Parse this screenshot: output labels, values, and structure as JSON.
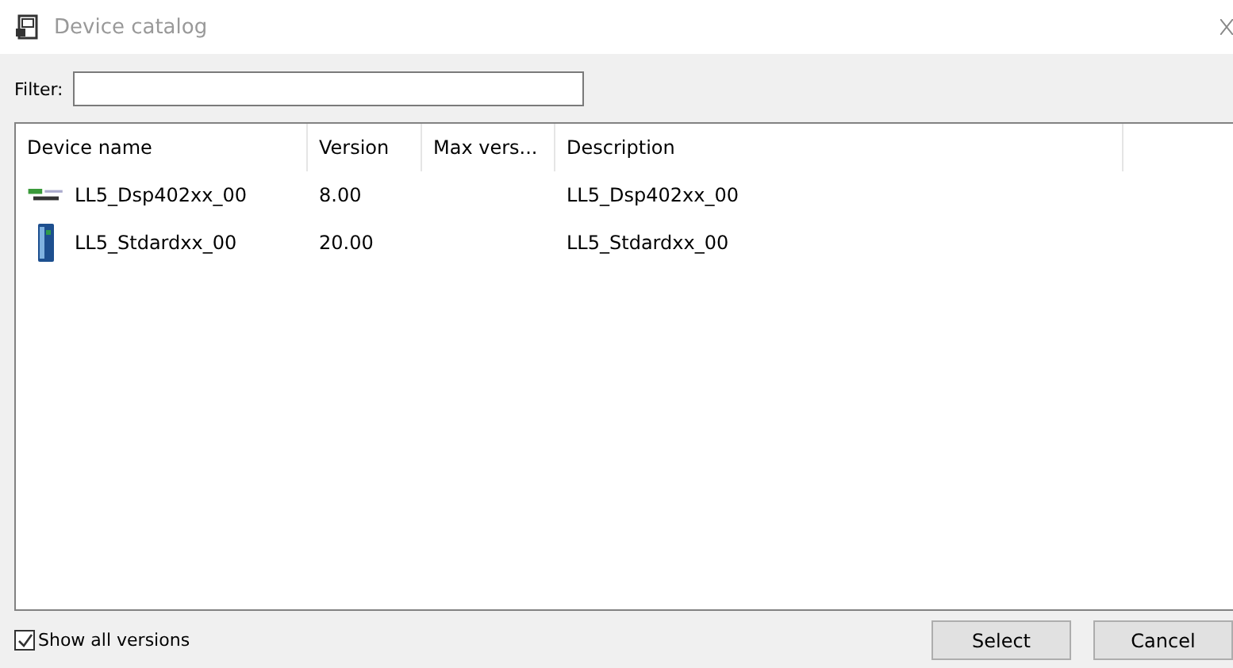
{
  "window": {
    "title": "Device catalog"
  },
  "filter": {
    "label": "Filter:"
  },
  "table": {
    "columns": [
      "Device name",
      "Version",
      "Max vers...",
      "Description"
    ],
    "rows": [
      {
        "kind": "display",
        "name": "LL5_Dsp402xx_00",
        "version": "8.00",
        "description": "LL5_Dsp402xx_00"
      },
      {
        "kind": "module",
        "name": "LL5_Stdardxx_00",
        "version": "20.00",
        "description": "LL5_Stdardxx_00"
      }
    ]
  },
  "show_all_versions": {
    "label": "Show all versions",
    "checked": true
  },
  "buttons": [
    "Select",
    "Cancel"
  ]
}
